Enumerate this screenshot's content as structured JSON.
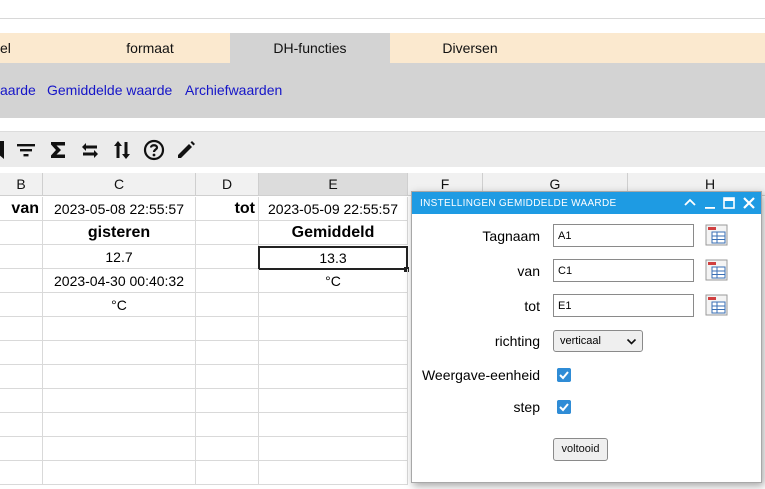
{
  "tabs": [
    {
      "label": "el",
      "active": false
    },
    {
      "label": "formaat",
      "active": false
    },
    {
      "label": "DH-functies",
      "active": true
    },
    {
      "label": "Diversen",
      "active": false
    }
  ],
  "links": [
    "aarde",
    "Gemiddelde waarde",
    "Archiefwaarden"
  ],
  "toolbar": {
    "icons": [
      "bookmark-icon",
      "filter-icon",
      "sigma-icon",
      "swap-horizontal-icon",
      "sort-vertical-icon",
      "help-icon",
      "pencil-icon"
    ]
  },
  "sheet": {
    "columns": [
      "B",
      "C",
      "D",
      "E",
      "F",
      "G",
      "H"
    ],
    "selected_column": "E",
    "rows": [
      [
        "van",
        "2023-05-08 22:55:57",
        "tot",
        "2023-05-09 22:55:57"
      ],
      [
        "",
        "gisteren",
        "",
        "Gemiddeld"
      ],
      [
        "",
        "12.7",
        "",
        "13.3"
      ],
      [
        "",
        "2023-04-30 00:40:32",
        "",
        "°C"
      ],
      [
        "",
        "°C",
        "",
        ""
      ]
    ],
    "selected_cell": "E3"
  },
  "dialog": {
    "title": "INSTELLINGEN GEMIDDELDE WAARDE",
    "fields": [
      {
        "label": "Tagnaam",
        "value": "A1"
      },
      {
        "label": "van",
        "value": "C1"
      },
      {
        "label": "tot",
        "value": "E1"
      }
    ],
    "richting": {
      "label": "richting",
      "value": "verticaal"
    },
    "checkboxes": [
      {
        "label": "Weergave-eenheid",
        "checked": true
      },
      {
        "label": "step",
        "checked": true
      }
    ],
    "submit_label": "voltooid"
  },
  "colors": {
    "accent": "#1e9be3",
    "tab_bg": "#fbe9cf",
    "link": "#1515c8"
  }
}
